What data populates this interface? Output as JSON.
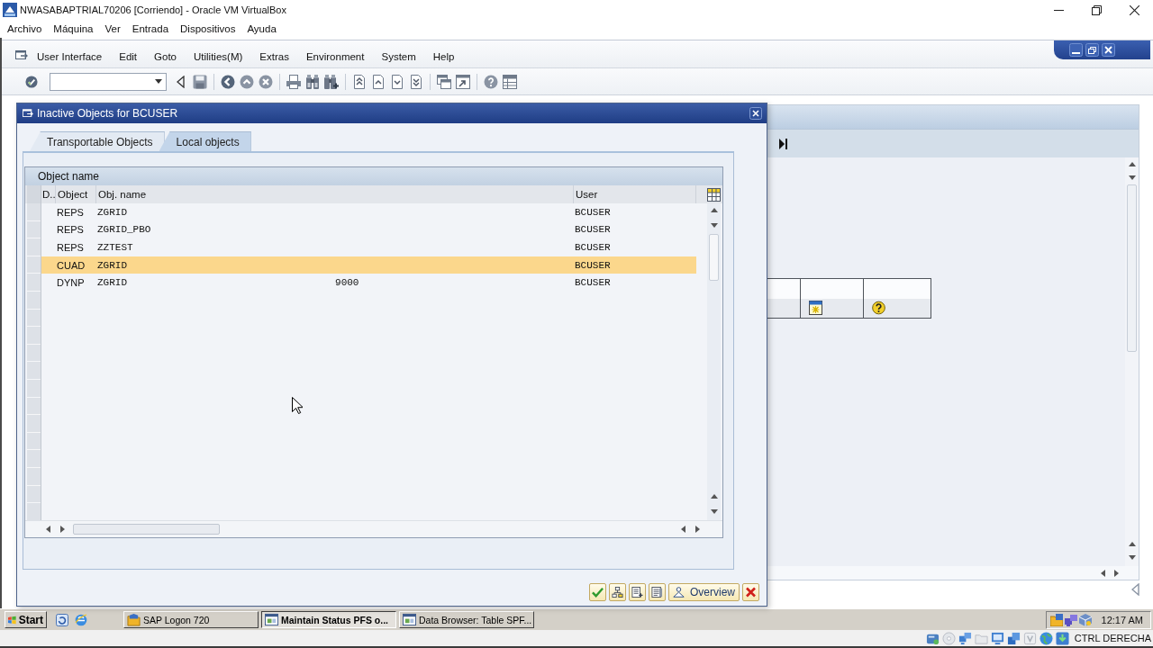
{
  "window": {
    "title": "NWASABAPTRIAL70206 [Corriendo] - Oracle VM VirtualBox"
  },
  "vm_menu": [
    "Archivo",
    "Máquina",
    "Ver",
    "Entrada",
    "Dispositivos",
    "Ayuda"
  ],
  "sap_menu": [
    "User Interface",
    "Edit",
    "Goto",
    "Utilities(M)",
    "Extras",
    "Environment",
    "System",
    "Help"
  ],
  "dialog": {
    "title": "Inactive Objects for BCUSER",
    "tabs": [
      {
        "label": "Transportable Objects",
        "selected": false
      },
      {
        "label": "Local objects",
        "selected": true
      }
    ],
    "grid": {
      "title": "Object name",
      "columns": [
        "D..",
        "Object",
        "Obj. name",
        "User"
      ],
      "rows": [
        {
          "object": "REPS",
          "obj_name": "ZGRID",
          "user": "BCUSER",
          "selected": false
        },
        {
          "object": "REPS",
          "obj_name": "ZGRID_PBO",
          "user": "BCUSER",
          "selected": false
        },
        {
          "object": "REPS",
          "obj_name": "ZZTEST",
          "user": "BCUSER",
          "selected": false
        },
        {
          "object": "CUAD",
          "obj_name": "ZGRID",
          "user": "BCUSER",
          "selected": true
        },
        {
          "object": "DYNP",
          "obj_name": "ZGRID                                   9000",
          "user": "BCUSER",
          "selected": false
        }
      ]
    },
    "overview_button": "Overview"
  },
  "taskbar": {
    "start": "Start",
    "tasks": [
      {
        "label": "SAP Logon 720",
        "kind": "logon",
        "selected": false
      },
      {
        "label": "Maintain Status PFS o...",
        "kind": "window",
        "selected": true
      },
      {
        "label": "Data Browser: Table SPF...",
        "kind": "window",
        "selected": false
      }
    ],
    "clock": "12:17 AM"
  },
  "status_bar": {
    "host_key": "CTRL DERECHA"
  }
}
